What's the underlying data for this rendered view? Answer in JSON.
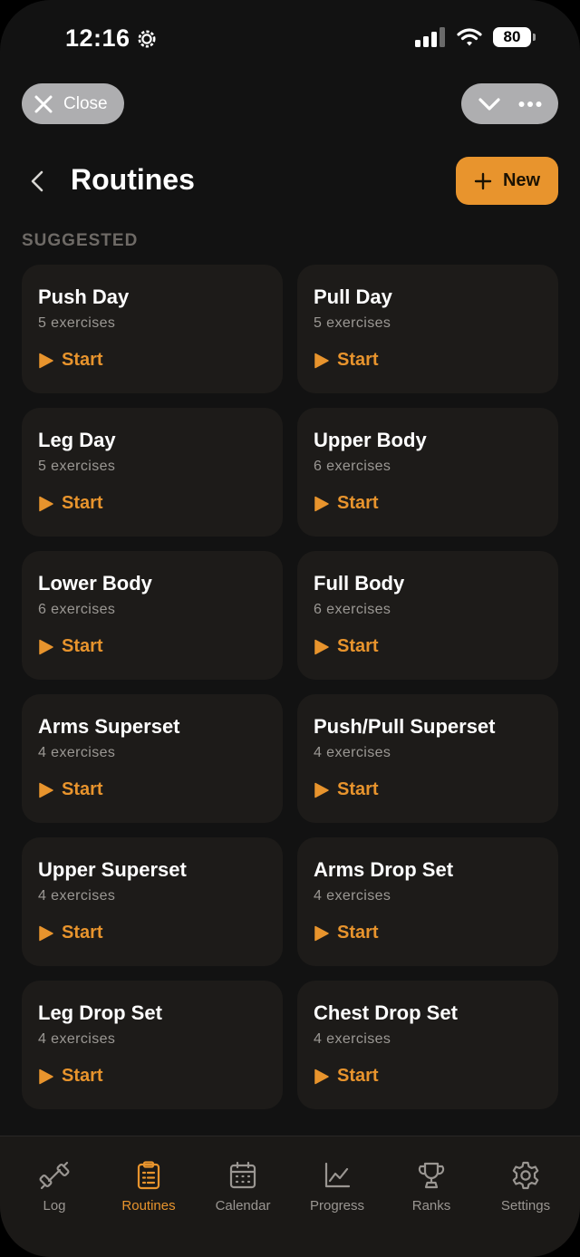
{
  "status_bar": {
    "time": "12:16",
    "battery": "80"
  },
  "top": {
    "close_label": "Close"
  },
  "header": {
    "title": "Routines",
    "new_label": "New"
  },
  "section_label": "SUGGESTED",
  "routines": [
    {
      "name": "Push Day",
      "count": "5 exercises",
      "start": "Start"
    },
    {
      "name": "Pull Day",
      "count": "5 exercises",
      "start": "Start"
    },
    {
      "name": "Leg Day",
      "count": "5 exercises",
      "start": "Start"
    },
    {
      "name": "Upper Body",
      "count": "6 exercises",
      "start": "Start"
    },
    {
      "name": "Lower Body",
      "count": "6 exercises",
      "start": "Start"
    },
    {
      "name": "Full Body",
      "count": "6 exercises",
      "start": "Start"
    },
    {
      "name": "Arms Superset",
      "count": "4 exercises",
      "start": "Start"
    },
    {
      "name": "Push/Pull Superset",
      "count": "4 exercises",
      "start": "Start"
    },
    {
      "name": "Upper Superset",
      "count": "4 exercises",
      "start": "Start"
    },
    {
      "name": "Arms Drop Set",
      "count": "4 exercises",
      "start": "Start"
    },
    {
      "name": "Leg Drop Set",
      "count": "4 exercises",
      "start": "Start"
    },
    {
      "name": "Chest Drop Set",
      "count": "4 exercises",
      "start": "Start"
    }
  ],
  "tabs": [
    {
      "label": "Log",
      "icon": "dumbbell-icon"
    },
    {
      "label": "Routines",
      "icon": "clipboard-icon",
      "active": true
    },
    {
      "label": "Calendar",
      "icon": "calendar-icon"
    },
    {
      "label": "Progress",
      "icon": "chart-icon"
    },
    {
      "label": "Ranks",
      "icon": "trophy-icon"
    },
    {
      "label": "Settings",
      "icon": "gear-icon"
    }
  ],
  "colors": {
    "accent": "#e8942d",
    "background": "#121212",
    "card": "#1d1b19",
    "tabbar": "#1b1917"
  }
}
